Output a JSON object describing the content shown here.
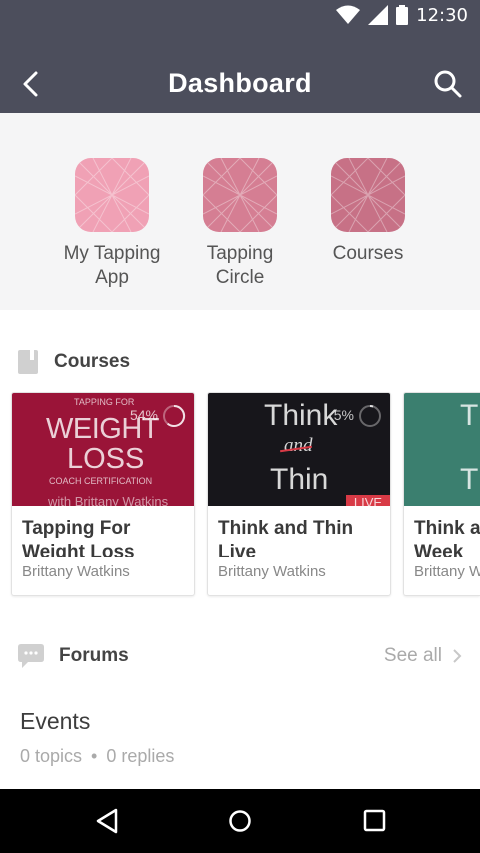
{
  "status": {
    "time": "12:30",
    "icons": [
      "wifi-icon",
      "signal-icon",
      "battery-icon"
    ]
  },
  "header": {
    "title": "Dashboard",
    "back_icon": "chevron-left-icon",
    "search_icon": "search-icon"
  },
  "shortcuts": [
    {
      "label_line1": "My Tapping",
      "label_line2": "App",
      "color": "#f0a1b5"
    },
    {
      "label_line1": "Tapping",
      "label_line2": "Circle",
      "color": "#d57e93"
    },
    {
      "label_line1": "Courses",
      "label_line2": "",
      "color": "#c77186"
    }
  ],
  "courses_section": {
    "title": "Courses",
    "icon": "book-icon",
    "items": [
      {
        "title_line1": "Tapping For",
        "title_line2": "Weight Loss",
        "author": "Brittany Watkins",
        "progress": "54%",
        "thumb": {
          "top": "TAPPING FOR",
          "big1": "WEIGHT",
          "big2": "LOSS",
          "sub": "COACH CERTIFICATION",
          "ribbon": "with Brittany Watkins"
        }
      },
      {
        "title_line1": "Think and Thin",
        "title_line2": "Live",
        "author": "Brittany Watkins",
        "progress": "5%",
        "thumb": {
          "w1": "Think",
          "w2": "and",
          "w3": "Thin",
          "ribbon": "LIVE"
        }
      },
      {
        "title_line1": "Think a",
        "title_line2": "Week",
        "author": "Brittany W",
        "thumb": {
          "w1": "T"
        }
      }
    ]
  },
  "forums_section": {
    "title": "Forums",
    "icon": "chat-bubble-icon",
    "see_all": "See all"
  },
  "events": {
    "title": "Events",
    "topics": "0 topics",
    "separator": "•",
    "replies": "0 replies"
  },
  "colors": {
    "bar": "#4c4e5c",
    "tiles_bg": "#f5f5f6",
    "card1": "#9a1438",
    "card2": "#17161b",
    "card3": "#3b7f6f"
  }
}
